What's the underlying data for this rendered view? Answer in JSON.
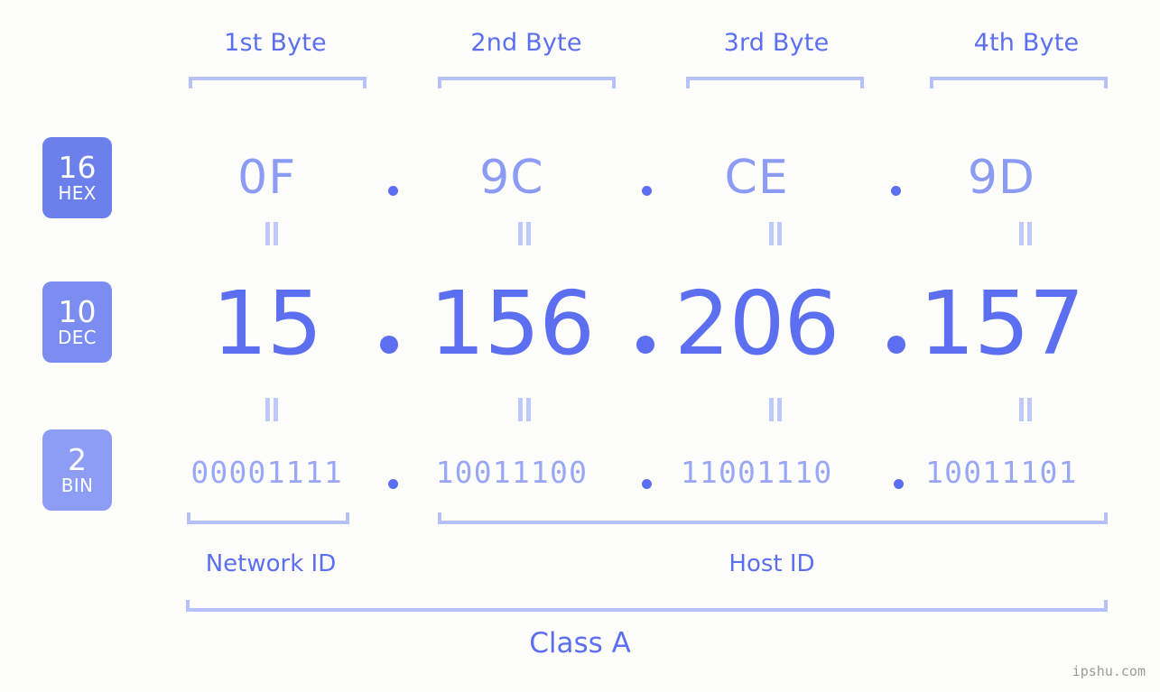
{
  "page": {
    "background_color": "#fdfefb",
    "accent_color": "#5c6ff0",
    "bracket_color": "#b6c0fb",
    "watermark": "ipshu.com"
  },
  "byte_headers": [
    {
      "label": "1st Byte"
    },
    {
      "label": "2nd Byte"
    },
    {
      "label": "3rd Byte"
    },
    {
      "label": "4th Byte"
    }
  ],
  "radix_badges": [
    {
      "number": "16",
      "name": "HEX",
      "color": "#6c80ec"
    },
    {
      "number": "10",
      "name": "DEC",
      "color": "#7b8df0"
    },
    {
      "number": "2",
      "name": "BIN",
      "color": "#8d9cf5"
    }
  ],
  "rows": {
    "hex": {
      "values": [
        "0F",
        "9C",
        "CE",
        "9D"
      ],
      "separator": "."
    },
    "dec": {
      "values": [
        "15",
        "156",
        "206",
        "157"
      ],
      "separator": "."
    },
    "bin": {
      "values": [
        "00001111",
        "10011100",
        "11001110",
        "10011101"
      ],
      "separator": "."
    }
  },
  "equals_symbol": "=",
  "sections": {
    "network_id": "Network ID",
    "host_id": "Host ID",
    "class": "Class A"
  },
  "ip_address": {
    "decimal": "15.156.206.157",
    "hexadecimal": "0F.9C.CE.9D",
    "binary": "00001111.10011100.11001110.10011101"
  }
}
